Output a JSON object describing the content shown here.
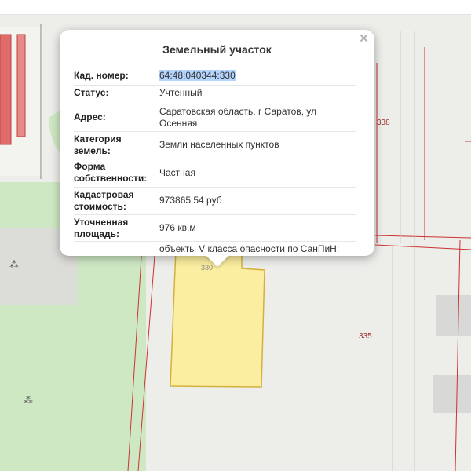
{
  "map": {
    "parcel_labels": [
      "338",
      "330",
      "335"
    ],
    "colors": {
      "background": "#ededea",
      "green_zone": "#cfe8c4",
      "boundary": "#cc3333",
      "parcel_fill": "#fbeea0",
      "parcel_stroke": "#d4b13c",
      "label": "#a33333"
    }
  },
  "popup": {
    "title": "Земельный участок",
    "close": "×",
    "rows": [
      {
        "label": "Кад. номер:",
        "value": "64:48:040344:330"
      },
      {
        "label": "Статус:",
        "value": "Учтенный"
      },
      {
        "label": "Адрес:",
        "value": "Саратовская область, г Саратов, ул Осенняя"
      },
      {
        "label": "Категория земель:",
        "value": "Земли населенных пунктов"
      },
      {
        "label": "Форма собственности:",
        "value": "Частная"
      },
      {
        "label": "Кадастровая стоимость:",
        "value": "973865.54 руб"
      },
      {
        "label": "Уточненная площадь:",
        "value": "976 кв.м"
      },
      {
        "label": "",
        "value": "объекты V класса опасности по СанПиН:"
      }
    ]
  }
}
